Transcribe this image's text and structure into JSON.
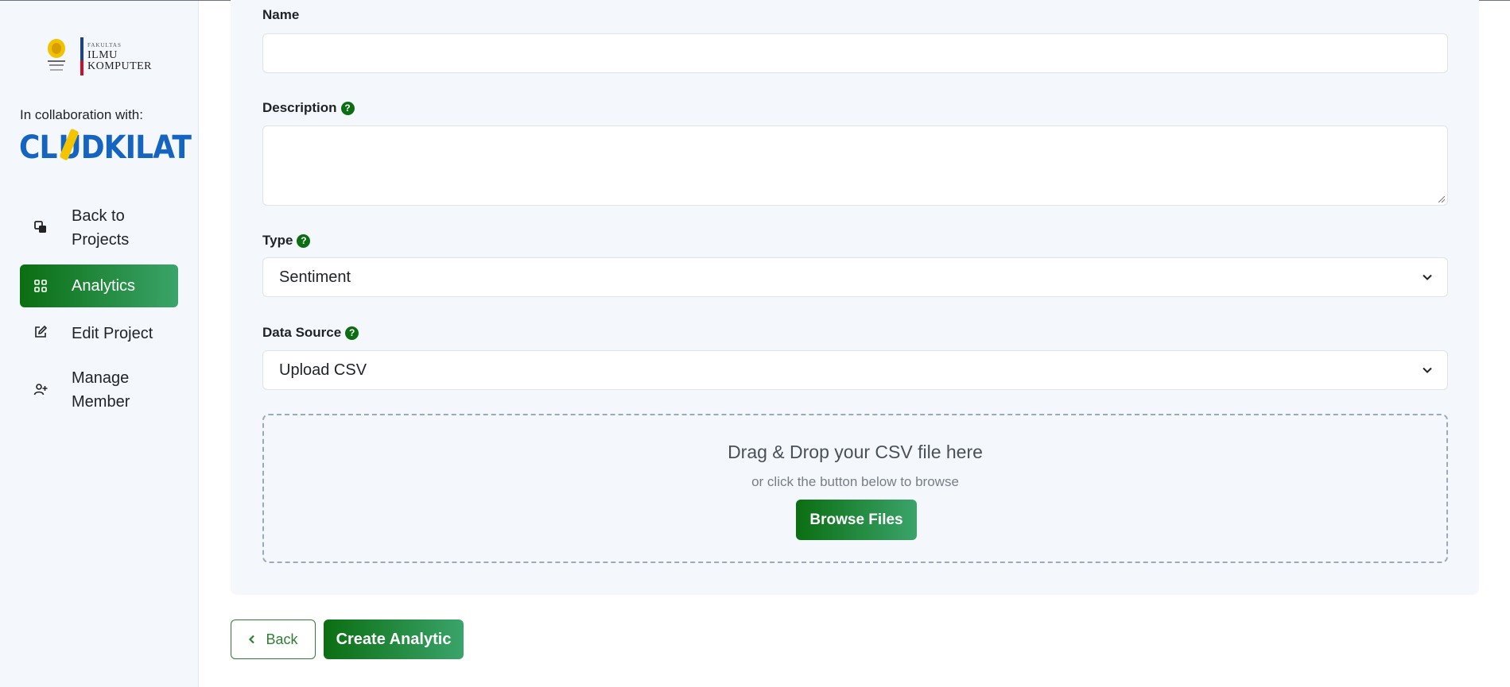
{
  "sidebar": {
    "university_logo": {
      "small_text": "FAKULTAS",
      "line1": "ILMU",
      "line2": "KOMPUTER"
    },
    "collab_text": "In collaboration with:",
    "partner_logo": {
      "pre": "CL",
      "post": "UDKILAT"
    },
    "nav": [
      {
        "label": "Back to Projects",
        "icon": "copy-icon"
      },
      {
        "label": "Analytics",
        "icon": "grid-icon",
        "active": true
      },
      {
        "label": "Edit Project",
        "icon": "edit-icon"
      },
      {
        "label": "Manage Member",
        "icon": "user-plus-icon"
      }
    ]
  },
  "form": {
    "name_label": "Name",
    "name_value": "",
    "description_label": "Description",
    "description_value": "",
    "type_label": "Type",
    "type_value": "Sentiment",
    "source_label": "Data Source",
    "source_value": "Upload CSV",
    "help_glyph": "?"
  },
  "dropzone": {
    "title": "Drag & Drop your CSV file here",
    "subtitle": "or click the button below to browse",
    "button": "Browse Files"
  },
  "actions": {
    "back": "Back",
    "create": "Create Analytic"
  },
  "colors": {
    "accent_dark": "#0b6e12",
    "accent_light": "#3aa46a",
    "panel_bg": "#f4f7fb",
    "brand_blue": "#1565c0"
  }
}
